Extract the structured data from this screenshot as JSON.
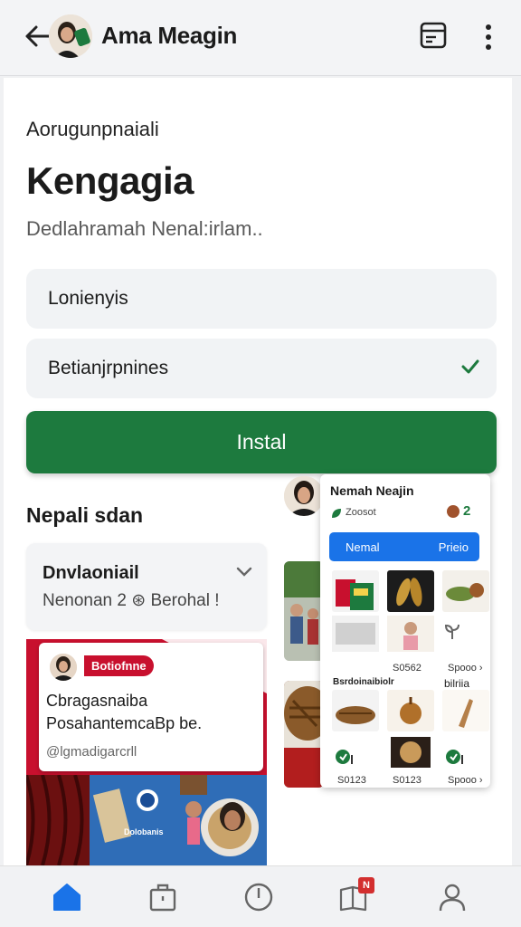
{
  "header": {
    "title": "Ama Meagin"
  },
  "main": {
    "overline": "Aorugunpnaiali",
    "headline": "Kengagia",
    "subline": "Dedlahramah Nenal:irlam..",
    "field1": "Lonienyis",
    "field2": "Betianjrpnines",
    "install_label": "Instal",
    "section_title": "Nepali sdan"
  },
  "info_card": {
    "title": "Dnvlaoniail",
    "subtitle": "Nenonan 2 ⊛ Berohal !"
  },
  "promo": {
    "tag": "Botiofnne",
    "line1": "Cbragasnaiba",
    "line2": "PosahantemcaBp be.",
    "line3": "@lgmadigarcrll",
    "logo_text": "Dolobanis"
  },
  "preview": {
    "name": "Nemah Neajin",
    "stat": "Zoosot",
    "badge_num": "2",
    "tab1": "Nemal",
    "tab2": "Prieio",
    "items": [
      {
        "price": ""
      },
      {
        "price": "S0562"
      },
      {
        "price": "Spooo ›"
      },
      {
        "price": "S0123"
      },
      {
        "price": "S0123"
      },
      {
        "price": "Spooo ›"
      }
    ],
    "cap1": "Bsrdoinaibiolr",
    "cap3": "bilriia"
  },
  "nav": {
    "badge": "N"
  },
  "colors": {
    "accent": "#1d7a3e",
    "blue": "#1a73e8",
    "red": "#c8102e"
  }
}
